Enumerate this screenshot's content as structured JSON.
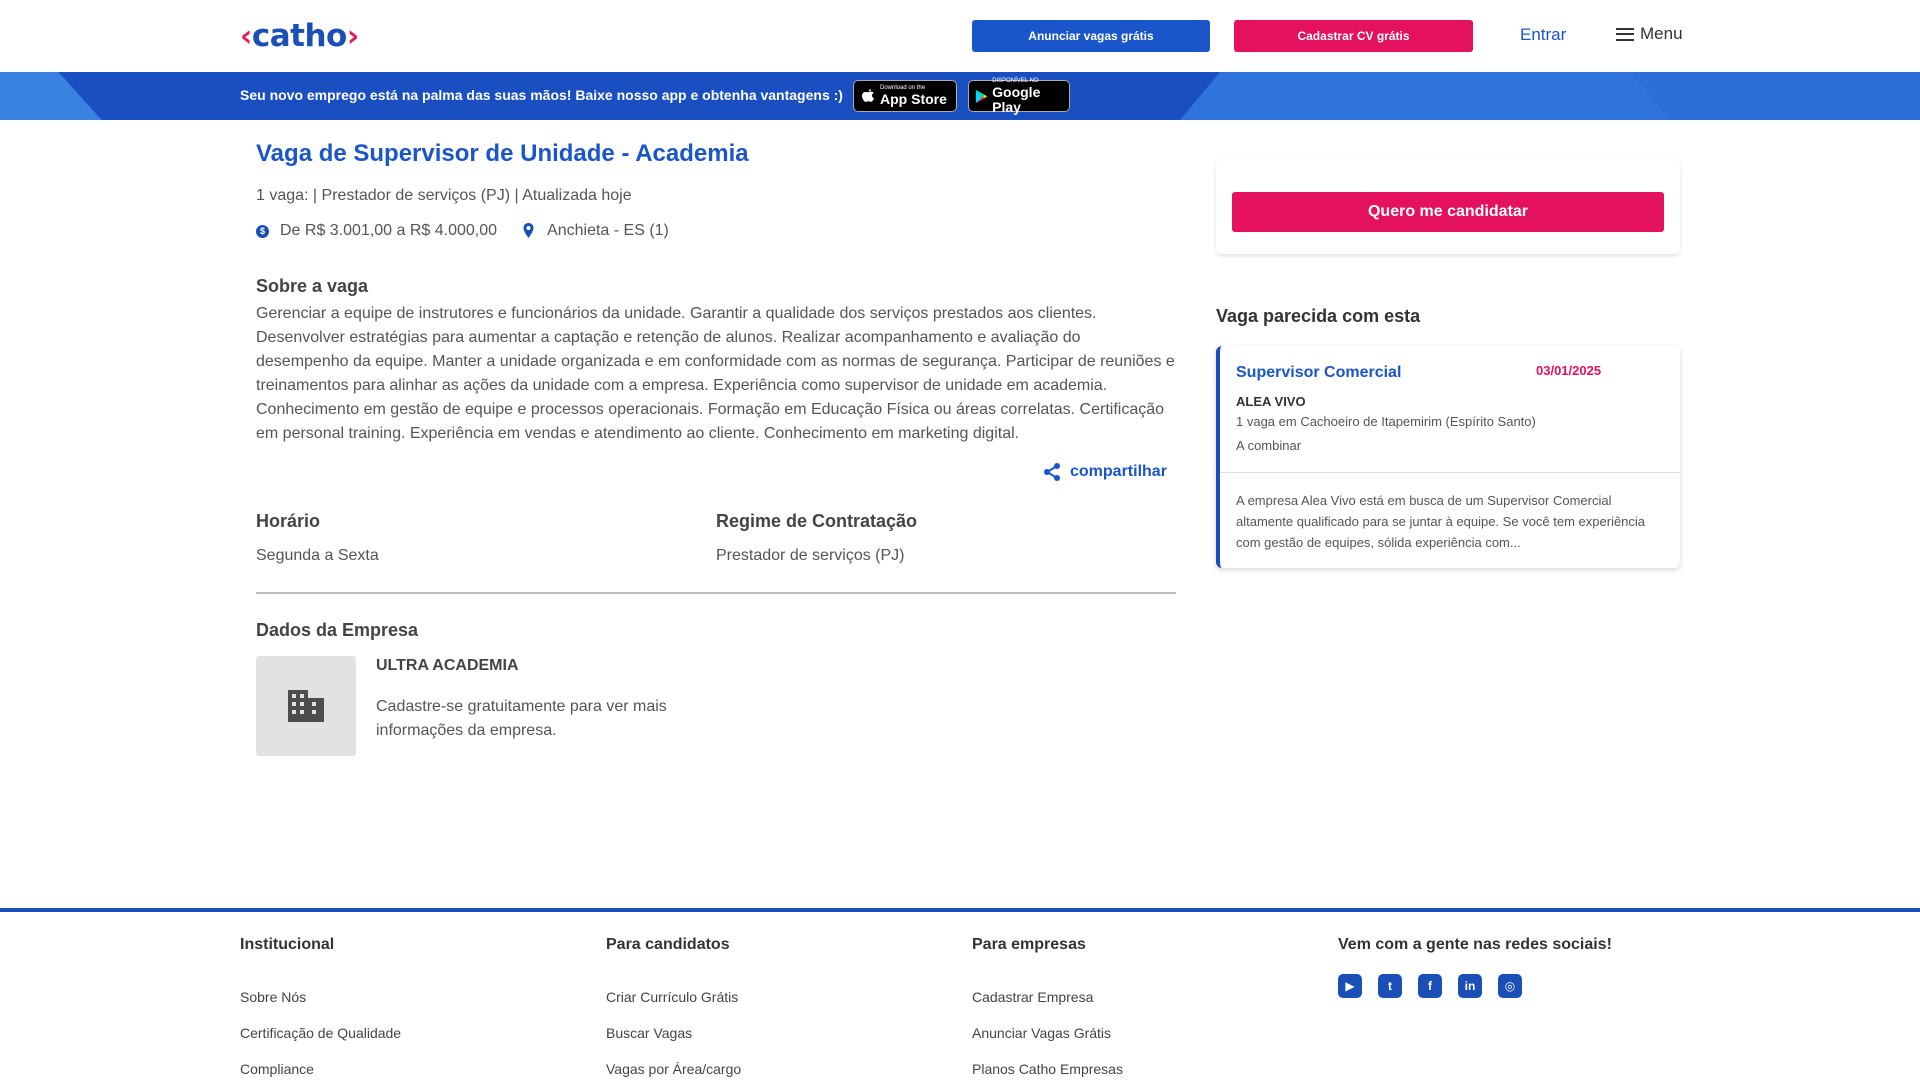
{
  "header": {
    "logo_text": "catho",
    "anunciar_label": "Anunciar vagas grátis",
    "cadastrar_label": "Cadastrar CV grátis",
    "entrar_label": "Entrar",
    "menu_label": "Menu"
  },
  "banner": {
    "text": "Seu novo emprego está na palma das suas mãos! Baixe nosso app e obtenha vantagens :)",
    "appstore_small": "Download on the",
    "appstore_large": "App Store",
    "gplay_small": "DISPONÍVEL NO",
    "gplay_large": "Google Play"
  },
  "job": {
    "title": "Vaga de Supervisor de Unidade - Academia",
    "meta": "1 vaga: | Prestador de serviços (PJ) | Atualizada hoje",
    "salary": "De R$ 3.001,00 a R$ 4.000,00",
    "location": "Anchieta - ES (1)",
    "about_heading": "Sobre a vaga",
    "description": "Gerenciar a equipe de instrutores e funcionários da unidade. Garantir a qualidade dos serviços prestados aos clientes. Desenvolver estratégias para aumentar a captação e retenção de alunos. Realizar acompanhamento e avaliação do desempenho da equipe. Manter a unidade organizada e em conformidade com as normas de segurança. Participar de reuniões e treinamentos para alinhar as ações da unidade com a empresa. Experiência como supervisor de unidade em academia. Conhecimento em gestão de equipe e processos operacionais. Formação em Educação Física ou áreas correlatas. Certificação em personal training. Experiência em vendas e atendimento ao cliente. Conhecimento em marketing digital.",
    "share_label": "compartilhar",
    "schedule_label": "Horário",
    "schedule_value": "Segunda a Sexta",
    "contract_label": "Regime de Contratação",
    "contract_value": "Prestador de serviços (PJ)"
  },
  "company": {
    "heading": "Dados da Empresa",
    "name": "ULTRA ACADEMIA",
    "note": "Cadastre-se gratuitamente para ver mais informações da empresa."
  },
  "sidebar": {
    "apply_label": "Quero me candidatar",
    "similar_heading": "Vaga parecida com esta",
    "similar": {
      "title": "Supervisor Comercial",
      "date": "03/01/2025",
      "company": "ALEA VIVO",
      "location": "1 vaga em Cachoeiro de Itapemirim (Espírito Santo)",
      "pay": "A combinar",
      "description": "A empresa Alea Vivo está em busca de um Supervisor Comercial altamente qualificado para se juntar à equipe. Se você tem experiência com gestão de equipes, sólida experiência com..."
    }
  },
  "footer": {
    "col1": {
      "heading": "Institucional",
      "links": [
        "Sobre Nós",
        "Certificação de Qualidade",
        "Compliance"
      ]
    },
    "col2": {
      "heading": "Para candidatos",
      "links": [
        "Criar Currículo Grátis",
        "Buscar Vagas",
        "Vagas por Área/cargo"
      ]
    },
    "col3": {
      "heading": "Para empresas",
      "links": [
        "Cadastrar Empresa",
        "Anunciar Vagas Grátis",
        "Planos Catho Empresas"
      ]
    },
    "col4": {
      "heading": "Vem com a gente nas redes sociais!"
    },
    "social_icons": [
      "youtube-icon",
      "twitter-icon",
      "facebook-icon",
      "linkedin-icon",
      "instagram-icon"
    ]
  },
  "colors": {
    "brand_blue": "#1a4fb8",
    "brand_pink": "#e3115e"
  }
}
